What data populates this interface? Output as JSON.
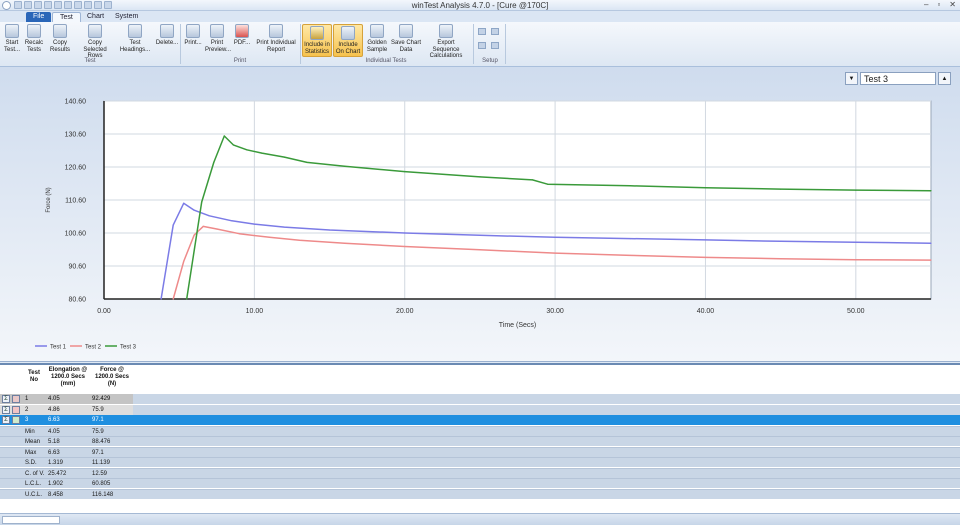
{
  "window": {
    "title": "winTest Analysis 4.7.0 - [Cure @170C]",
    "controls": [
      "–",
      "▫",
      "✕"
    ]
  },
  "tabs": {
    "file": "File",
    "test": "Test",
    "chart": "Chart",
    "system": "System"
  },
  "ribbon": {
    "start_test": "Start Test...",
    "recalc_tests": "Recalc Tests",
    "copy_results": "Copy Results",
    "copy_selected_rows": "Copy Selected Rows",
    "test_headings": "Test Headings...",
    "delete": "Delete...",
    "print": "Print...",
    "print_preview": "Print Preview...",
    "pdf": "PDF...",
    "print_individual_report": "Print Individual Report",
    "include_in_statistics": "Include in Statistics",
    "include_on_chart": "Include On Chart",
    "golden_sample": "Golden Sample",
    "save_chart_data": "Save Chart Data",
    "export_sequence_calculations": "Export Sequence Calculations",
    "groups": {
      "test": "Test",
      "print": "Print",
      "individual_tests": "Individual Tests",
      "setup": "Setup"
    }
  },
  "test_selector": {
    "value": "Test 3",
    "down": "▼",
    "up": "▲"
  },
  "chart_data": {
    "type": "line",
    "xlabel": "Time (Secs)",
    "ylabel": "Force (N)",
    "xlim": [
      0,
      55
    ],
    "ylim": [
      80.6,
      140.6
    ],
    "x_ticks": [
      0,
      10,
      20,
      30,
      40,
      50
    ],
    "x_tick_labels": [
      "0.00",
      "10.00",
      "20.00",
      "30.00",
      "40.00",
      "50.00"
    ],
    "y_ticks": [
      80.6,
      90.6,
      100.6,
      110.6,
      120.6,
      130.6,
      140.6
    ],
    "y_tick_labels": [
      "80.60",
      "90.60",
      "100.60",
      "110.60",
      "120.60",
      "130.60",
      "140.60"
    ],
    "grid": true,
    "legend_position": "bottom-left",
    "series": [
      {
        "name": "Test 1",
        "color": "#7b7be6",
        "x": [
          3.8,
          4.6,
          5.3,
          6.0,
          7.0,
          8.5,
          10,
          12,
          15,
          20,
          25,
          30,
          35,
          40,
          45,
          50,
          55
        ],
        "y": [
          80.6,
          103.0,
          109.6,
          107.5,
          105.8,
          104.3,
          103.3,
          102.4,
          101.5,
          100.6,
          99.9,
          99.3,
          98.9,
          98.5,
          98.1,
          97.8,
          97.5
        ]
      },
      {
        "name": "Test 2",
        "color": "#ee8a8a",
        "x": [
          4.6,
          5.3,
          6.0,
          6.6,
          7.5,
          9,
          11,
          13,
          16,
          20,
          25,
          30,
          35,
          40,
          45,
          50,
          55
        ],
        "y": [
          80.6,
          92.0,
          100.0,
          102.6,
          101.8,
          100.4,
          99.3,
          98.4,
          97.5,
          96.5,
          95.5,
          94.5,
          93.8,
          93.2,
          92.8,
          92.5,
          92.4
        ]
      },
      {
        "name": "Test 3",
        "color": "#3a9a3a",
        "x": [
          5.5,
          6.5,
          7.3,
          8.0,
          8.6,
          9.5,
          10.5,
          12,
          13.5,
          16,
          20,
          25,
          28.5,
          29.5,
          35,
          40,
          45,
          50,
          55
        ],
        "y": [
          80.6,
          110.0,
          122.0,
          130.0,
          127.3,
          125.8,
          124.8,
          123.6,
          122.0,
          120.8,
          119.2,
          117.6,
          116.7,
          115.4,
          114.9,
          114.3,
          113.9,
          113.6,
          113.4
        ]
      }
    ]
  },
  "table": {
    "headers": {
      "test_no": "Test No",
      "elongation": "Elongation @ 1200.0 Secs (mm)",
      "force": "Force @ 1200.0 Secs (N)"
    },
    "rows": [
      {
        "no": "1",
        "elongation": "4.05",
        "force": "92.429"
      },
      {
        "no": "2",
        "elongation": "4.86",
        "force": "75.9"
      },
      {
        "no": "3",
        "elongation": "6.63",
        "force": "97.1"
      }
    ],
    "stats": [
      {
        "label": "Min",
        "elongation": "4.05",
        "force": "75.9"
      },
      {
        "label": "Mean",
        "elongation": "5.18",
        "force": "88.476"
      },
      {
        "label": "Max",
        "elongation": "6.63",
        "force": "97.1"
      },
      {
        "label": "S.D.",
        "elongation": "1.319",
        "force": "11.139"
      },
      {
        "label": "C. of V.",
        "elongation": "25.472",
        "force": "12.59"
      },
      {
        "label": "L.C.L.",
        "elongation": "1.902",
        "force": "60.805"
      },
      {
        "label": "U.C.L.",
        "elongation": "8.458",
        "force": "116.148"
      }
    ],
    "sigma_symbol": "Σ"
  }
}
